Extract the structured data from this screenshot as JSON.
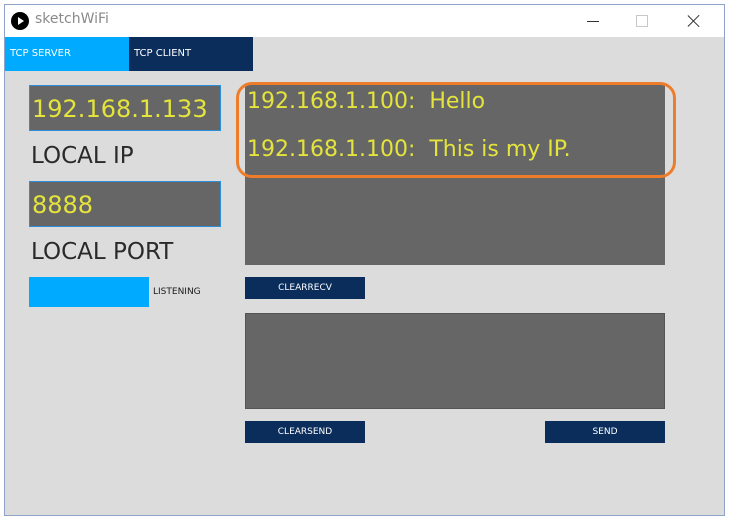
{
  "window": {
    "title": "sketchWiFi"
  },
  "tabs": [
    {
      "label": "TCP SERVER",
      "active": true
    },
    {
      "label": "TCP CLIENT",
      "active": false
    }
  ],
  "server": {
    "local_ip": "192.168.1.133",
    "local_ip_label": "LOCAL IP",
    "local_port": "8888",
    "local_port_label": "LOCAL PORT",
    "listening_label": "LISTENING"
  },
  "receive": {
    "lines": [
      "192.168.1.100:  Hello",
      "192.168.1.100:  This is my IP."
    ],
    "clear_label": "CLEARRECV"
  },
  "send": {
    "text": "",
    "clear_label": "CLEARSEND",
    "send_label": "SEND"
  },
  "colors": {
    "accent": "#00aaff",
    "navy": "#0a2d5c",
    "field_bg": "#666666",
    "field_text": "#e4e43c",
    "highlight": "#ee7d2b"
  },
  "icons": {
    "app": "play-circle-icon",
    "minimize": "minimize-icon",
    "maximize": "maximize-icon",
    "close": "close-icon"
  }
}
